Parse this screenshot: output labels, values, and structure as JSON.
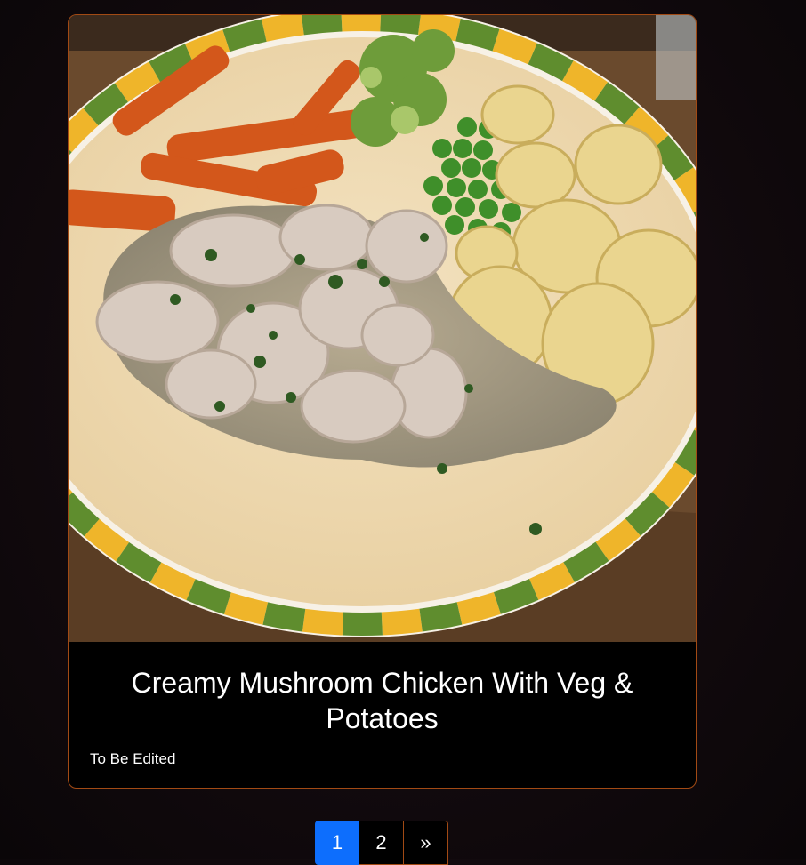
{
  "recipe": {
    "title": "Creamy Mushroom Chicken With Veg & Potatoes",
    "description": "To Be Edited",
    "image_alt": "Plate of creamy mushroom chicken with roasted carrots, broccoli, peas and boiled potatoes"
  },
  "pagination": {
    "pages": [
      "1",
      "2"
    ],
    "current": "1",
    "next_label": "»"
  },
  "colors": {
    "card_border": "#a24a14",
    "active_page": "#0d6efd",
    "card_background": "#000000"
  }
}
